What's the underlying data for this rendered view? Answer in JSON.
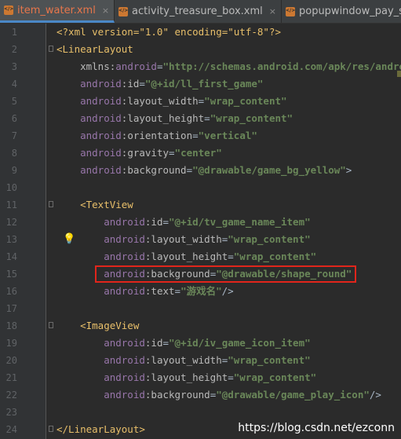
{
  "tabs": [
    {
      "label": "item_water.xml",
      "active": true
    },
    {
      "label": "activity_treasure_box.xml",
      "active": false
    },
    {
      "label": "popupwindow_pay_sel",
      "active": false
    }
  ],
  "close_glyph": "×",
  "lines": [
    {
      "n": "1",
      "tokens": [
        [
          "decl",
          "<?xml version=\"1.0\" encoding=\"utf-8\"?>"
        ]
      ]
    },
    {
      "n": "2",
      "fold": true,
      "tokens": [
        [
          "tag",
          "<LinearLayout"
        ]
      ]
    },
    {
      "n": "3",
      "tokens": [
        [
          "attr",
          "    xmlns:"
        ],
        [
          "ns",
          "android"
        ],
        [
          "pun",
          "="
        ],
        [
          "val",
          "\"http://schemas.android.com/apk/res/andro"
        ]
      ]
    },
    {
      "n": "4",
      "tokens": [
        [
          "ns",
          "    android"
        ],
        [
          "attr",
          ":id"
        ],
        [
          "pun",
          "="
        ],
        [
          "val",
          "\"@+id/ll_first_game\""
        ]
      ]
    },
    {
      "n": "5",
      "tokens": [
        [
          "ns",
          "    android"
        ],
        [
          "attr",
          ":layout_width"
        ],
        [
          "pun",
          "="
        ],
        [
          "val",
          "\"wrap_content\""
        ]
      ]
    },
    {
      "n": "6",
      "tokens": [
        [
          "ns",
          "    android"
        ],
        [
          "attr",
          ":layout_height"
        ],
        [
          "pun",
          "="
        ],
        [
          "val",
          "\"wrap_content\""
        ]
      ]
    },
    {
      "n": "7",
      "tokens": [
        [
          "ns",
          "    android"
        ],
        [
          "attr",
          ":orientation"
        ],
        [
          "pun",
          "="
        ],
        [
          "val",
          "\"vertical\""
        ]
      ]
    },
    {
      "n": "8",
      "tokens": [
        [
          "ns",
          "    android"
        ],
        [
          "attr",
          ":gravity"
        ],
        [
          "pun",
          "="
        ],
        [
          "val",
          "\"center\""
        ]
      ]
    },
    {
      "n": "9",
      "tokens": [
        [
          "ns",
          "    android"
        ],
        [
          "attr",
          ":background"
        ],
        [
          "pun",
          "="
        ],
        [
          "val",
          "\"@drawable/game_bg_yellow\""
        ],
        [
          "pun",
          ">"
        ]
      ]
    },
    {
      "n": "10",
      "tokens": []
    },
    {
      "n": "11",
      "fold": true,
      "tokens": [
        [
          "tag",
          "    <TextView"
        ]
      ]
    },
    {
      "n": "12",
      "tokens": [
        [
          "ns",
          "        android"
        ],
        [
          "attr",
          ":id"
        ],
        [
          "pun",
          "="
        ],
        [
          "val",
          "\"@+id/tv_game_name_item\""
        ]
      ]
    },
    {
      "n": "13",
      "bulb": true,
      "tokens": [
        [
          "ns",
          "        android"
        ],
        [
          "attr",
          ":layout_width"
        ],
        [
          "pun",
          "="
        ],
        [
          "val",
          "\"wrap_content\""
        ]
      ]
    },
    {
      "n": "14",
      "tokens": [
        [
          "ns",
          "        android"
        ],
        [
          "attr",
          ":layout_height"
        ],
        [
          "pun",
          "="
        ],
        [
          "val",
          "\"wrap_content\""
        ]
      ]
    },
    {
      "n": "15",
      "tokens": [
        [
          "ns",
          "        android"
        ],
        [
          "attr",
          ":background"
        ],
        [
          "pun",
          "="
        ],
        [
          "val",
          "\"@drawable/shape_round\""
        ]
      ]
    },
    {
      "n": "16",
      "tokens": [
        [
          "ns",
          "        android"
        ],
        [
          "attr",
          ":text"
        ],
        [
          "pun",
          "="
        ],
        [
          "val",
          "\"游戏名\""
        ],
        [
          "pun",
          "/>"
        ]
      ]
    },
    {
      "n": "17",
      "tokens": []
    },
    {
      "n": "18",
      "fold": true,
      "tokens": [
        [
          "tag",
          "    <ImageView"
        ]
      ]
    },
    {
      "n": "19",
      "tokens": [
        [
          "ns",
          "        android"
        ],
        [
          "attr",
          ":id"
        ],
        [
          "pun",
          "="
        ],
        [
          "val",
          "\"@+id/iv_game_icon_item\""
        ]
      ]
    },
    {
      "n": "20",
      "tokens": [
        [
          "ns",
          "        android"
        ],
        [
          "attr",
          ":layout_width"
        ],
        [
          "pun",
          "="
        ],
        [
          "val",
          "\"wrap_content\""
        ]
      ]
    },
    {
      "n": "21",
      "tokens": [
        [
          "ns",
          "        android"
        ],
        [
          "attr",
          ":layout_height"
        ],
        [
          "pun",
          "="
        ],
        [
          "val",
          "\"wrap_content\""
        ]
      ]
    },
    {
      "n": "22",
      "tokens": [
        [
          "ns",
          "        android"
        ],
        [
          "attr",
          ":background"
        ],
        [
          "pun",
          "="
        ],
        [
          "val",
          "\"@drawable/game_play_icon\""
        ],
        [
          "pun",
          "/>"
        ]
      ]
    },
    {
      "n": "23",
      "tokens": []
    },
    {
      "n": "24",
      "fold": true,
      "tokens": [
        [
          "tag",
          "</LinearLayout>"
        ]
      ]
    }
  ],
  "highlighted_line": "15",
  "watermark": "https://blog.csdn.net/ezconn"
}
